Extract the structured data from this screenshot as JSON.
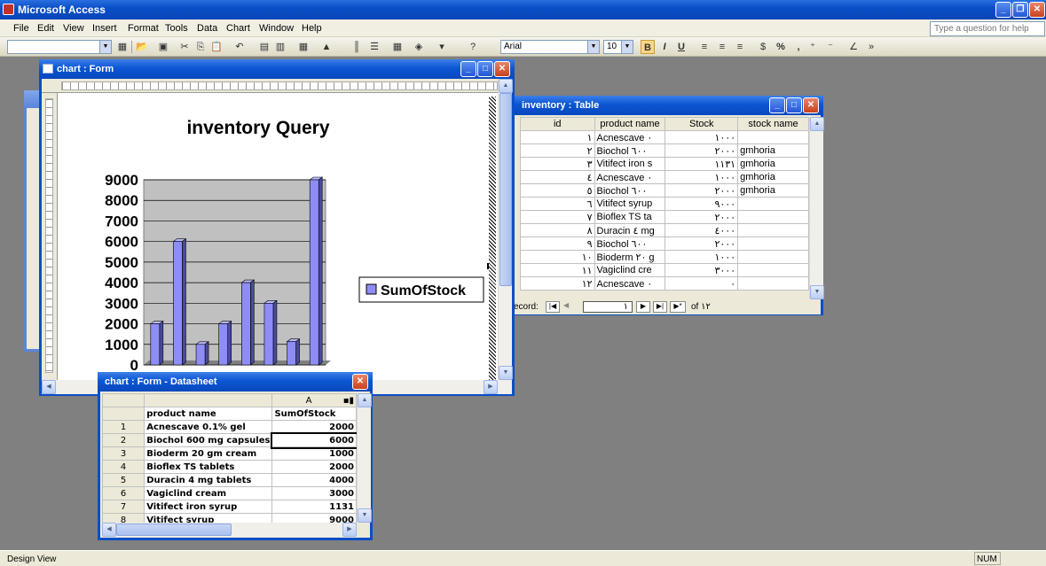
{
  "app": {
    "title": "Microsoft Access",
    "status": "Design View",
    "num": "NUM"
  },
  "menu": [
    "File",
    "Edit",
    "View",
    "Insert",
    "Format",
    "Tools",
    "Data",
    "Chart",
    "Window",
    "Help"
  ],
  "help_placeholder": "Type a question for help",
  "toolbar": {
    "font": "Arial",
    "size": "10",
    "bold": "B",
    "italic": "I",
    "underline": "U",
    "percent": "%",
    "comma": ","
  },
  "chart_form": {
    "title": "chart : Form"
  },
  "chart_data": {
    "type": "bar",
    "title": "inventory Query",
    "categories": [
      "Acnescave 0.1% gel",
      "Biochol 600 mg capsules",
      "Bioderm 20 gm cream",
      "Bioflex TS tablets",
      "Duracin 4 mg tablets",
      "Vagiclind cream",
      "Vitifect iron syrup",
      "Vitifect syrup"
    ],
    "visible_tick_labels": [
      "Acnescave\n0.1% gel",
      "Duracin 4\nmg tablets"
    ],
    "values": [
      2000,
      6000,
      1000,
      2000,
      4000,
      3000,
      1131,
      9000
    ],
    "yticks": [
      "9000",
      "8000",
      "7000",
      "6000",
      "5000",
      "4000",
      "3000",
      "2000",
      "1000",
      "0"
    ],
    "ylim": [
      0,
      9000
    ],
    "legend": "SumOfStock",
    "legend_position": "right",
    "grid": true
  },
  "inventory_table": {
    "title": "inventory : Table",
    "columns": [
      "id",
      "product name",
      "Stock",
      "stock name"
    ],
    "rows": [
      [
        "١",
        "Acnescave ٠",
        "١٠٠٠",
        ""
      ],
      [
        "٢",
        "Biochol ٦٠٠",
        "٢٠٠٠",
        "gmhoria"
      ],
      [
        "٣",
        "Vitifect iron s",
        "١١٣١",
        "gmhoria"
      ],
      [
        "٤",
        "Acnescave ٠",
        "١٠٠٠",
        "gmhoria"
      ],
      [
        "٥",
        "Biochol ٦٠٠",
        "٢٠٠٠",
        "gmhoria"
      ],
      [
        "٦",
        "Vitifect syrup",
        "٩٠٠٠",
        ""
      ],
      [
        "٧",
        "Bioflex TS ta",
        "٢٠٠٠",
        ""
      ],
      [
        "٨",
        "Duracin ٤ mg",
        "٤٠٠٠",
        ""
      ],
      [
        "٩",
        "Biochol ٦٠٠",
        "٢٠٠٠",
        ""
      ],
      [
        "١٠",
        "Bioderm ٢٠ g",
        "١٠٠٠",
        ""
      ],
      [
        "١١",
        "Vagiclind cre",
        "٣٠٠٠",
        ""
      ],
      [
        "١٢",
        "Acnescave ٠",
        "٠",
        ""
      ]
    ],
    "record_label": "ecord:",
    "record_value": "١",
    "record_of": "of ١٢"
  },
  "datasheet": {
    "title": "chart : Form - Datasheet",
    "col_letter": "A",
    "header": [
      "product name",
      "SumOfStock"
    ],
    "rows": [
      [
        "1",
        "Acnescave 0.1% gel",
        "2000"
      ],
      [
        "2",
        "Biochol 600 mg capsules",
        "6000"
      ],
      [
        "3",
        "Bioderm 20 gm cream",
        "1000"
      ],
      [
        "4",
        "Bioflex TS tablets",
        "2000"
      ],
      [
        "5",
        "Duracin 4 mg tablets",
        "4000"
      ],
      [
        "6",
        "Vagiclind cream",
        "3000"
      ],
      [
        "7",
        "Vitifect iron syrup",
        "1131"
      ],
      [
        "8",
        "Vitifect syrup",
        "9000"
      ]
    ]
  }
}
